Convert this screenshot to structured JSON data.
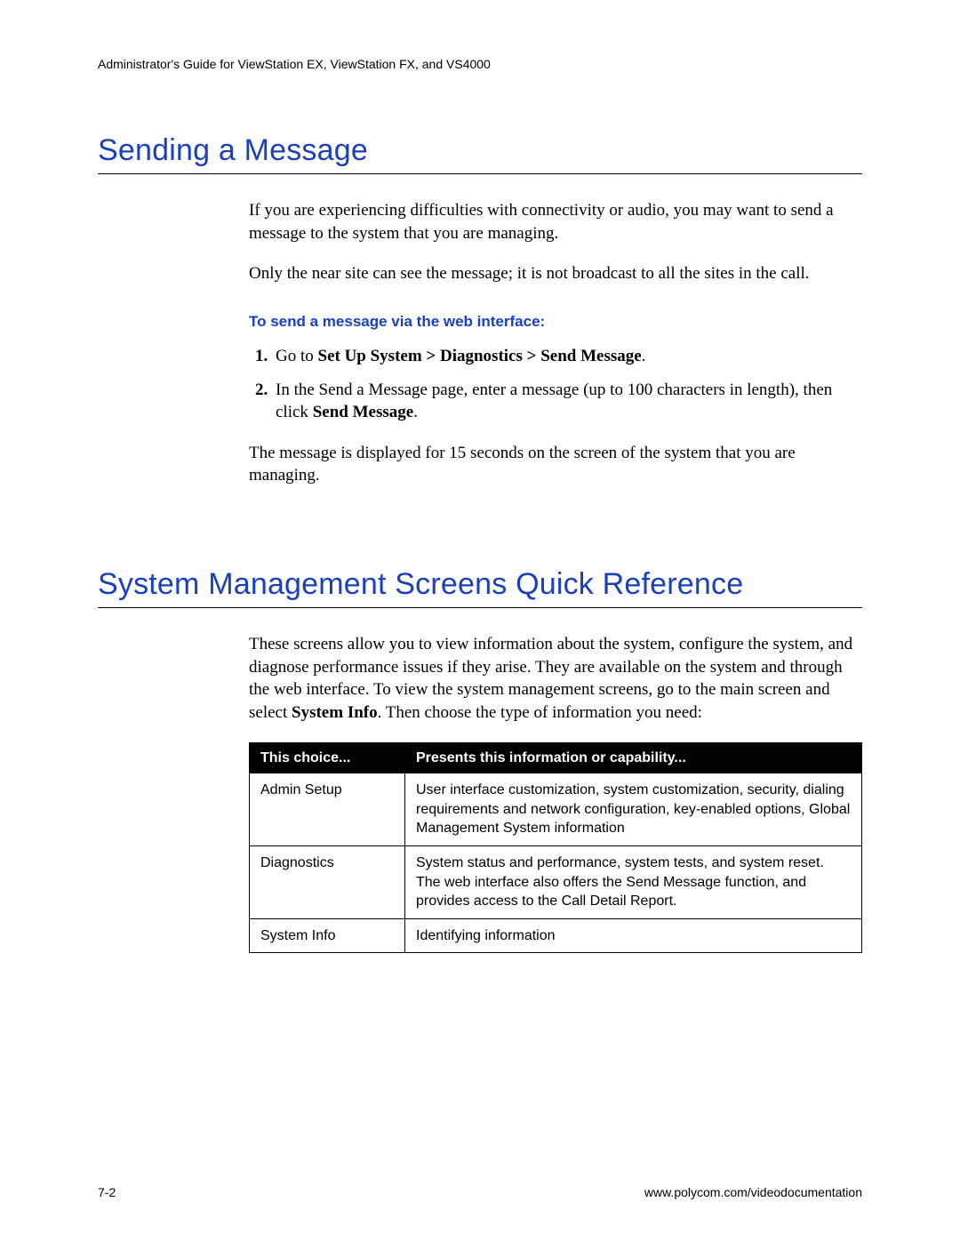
{
  "header": {
    "running_head": "Administrator's Guide for ViewStation EX, ViewStation FX, and VS4000"
  },
  "section1": {
    "title": "Sending a Message",
    "p1": "If you are experiencing difficulties with connectivity or audio, you may want to send a message to the system that you are managing.",
    "p2": "Only the near site can see the message; it is not broadcast to all the sites in the call.",
    "subhead": "To send a message via the web interface:",
    "step1_prefix": "Go to ",
    "step1_bold": "Set Up System > Diagnostics > Send Message",
    "step1_suffix": ".",
    "step2_a": "In the Send a Message page, enter a message (up to 100 characters in length), then click ",
    "step2_bold": "Send Message",
    "step2_b": ".",
    "p3": "The message is displayed for 15 seconds on the screen of the system that you are managing."
  },
  "section2": {
    "title": "System Management Screens Quick Reference",
    "p1_a": "These screens allow you to view information about the system, configure the system, and diagnose performance issues if they arise. They are available on the system and through the web interface. To view the system management screens, go to the main screen and select ",
    "p1_bold": "System Info",
    "p1_b": ". Then choose the type of information you need:",
    "table": {
      "head_col1": "This choice...",
      "head_col2": "Presents this information or capability...",
      "rows": [
        {
          "choice": "Admin Setup",
          "desc": "User interface customization, system customization, security, dialing requirements and network configuration, key-enabled options, Global Management System information"
        },
        {
          "choice": "Diagnostics",
          "desc": "System status and performance, system tests, and system reset. The web interface also offers the Send Message function, and provides access to the Call Detail Report."
        },
        {
          "choice": "System Info",
          "desc": "Identifying information"
        }
      ]
    }
  },
  "footer": {
    "page_num": "7-2",
    "url": "www.polycom.com/videodocumentation"
  }
}
